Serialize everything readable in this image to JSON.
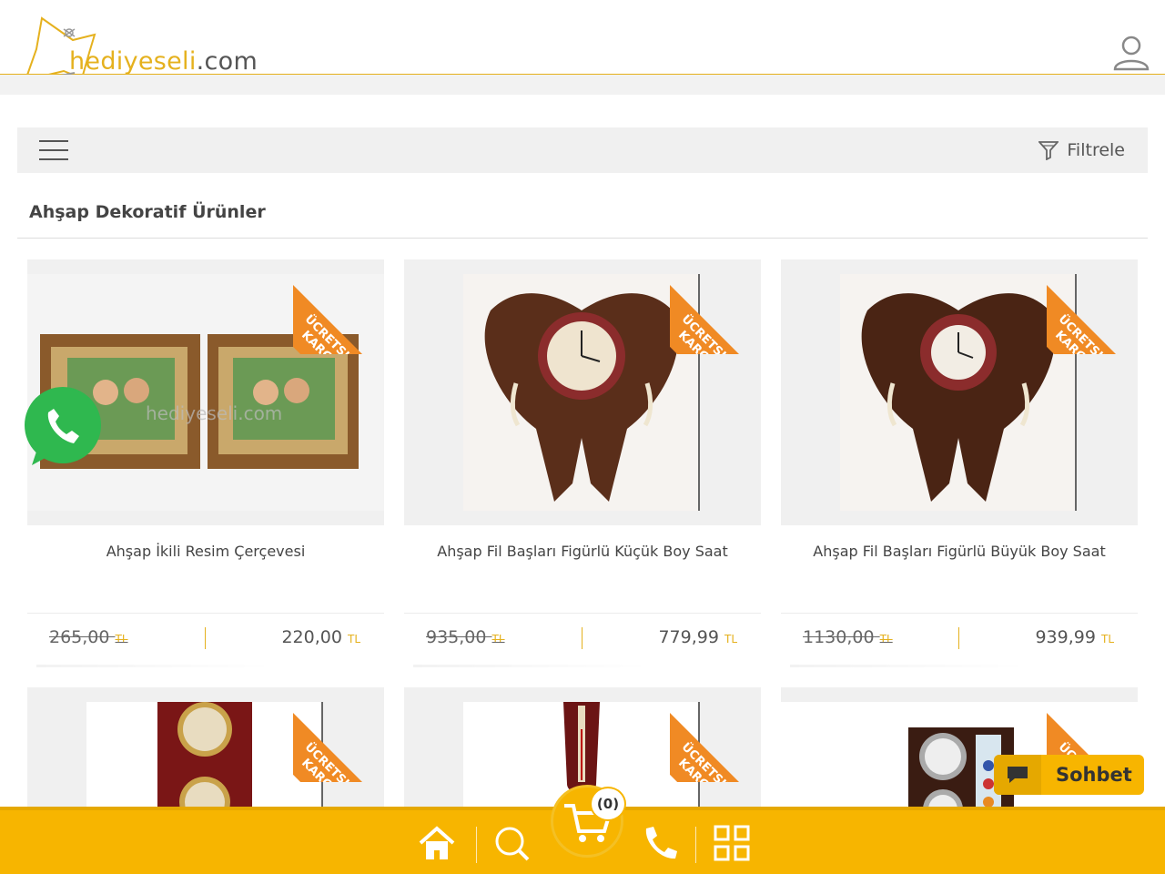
{
  "header": {
    "logo_prefix": "hediyeseli",
    "logo_suffix": ".com"
  },
  "toolbar": {
    "filter_label": "Filtrele"
  },
  "section": {
    "title": "Ahşap Dekoratif Ürünler"
  },
  "products": [
    {
      "name": "Ahşap İkili Resim Çerçevesi",
      "old_price": "265,00",
      "new_price": "220,00",
      "currency": "TL",
      "badge": "ÜCRETSIZ KARGO"
    },
    {
      "name": "Ahşap Fil Başları Figürlü Küçük Boy Saat",
      "old_price": "935,00",
      "new_price": "779,99",
      "currency": "TL",
      "badge": "ÜCRETSIZ KARGO"
    },
    {
      "name": "Ahşap Fil Başları Figürlü Büyük Boy Saat",
      "old_price": "1130,00",
      "new_price": "939,99",
      "currency": "TL",
      "badge": "ÜCRETSIZ KARGO"
    },
    {
      "badge": "ÜCRETSIZ KARGO"
    },
    {
      "badge": "ÜCRETSIZ KARGO"
    },
    {
      "badge": "ÜCRETSIZ KARGO"
    }
  ],
  "chat": {
    "label": "Sohbet"
  },
  "cart": {
    "count": "(0)"
  },
  "colors": {
    "accent": "#f7b500",
    "badge": "#f08a24"
  }
}
